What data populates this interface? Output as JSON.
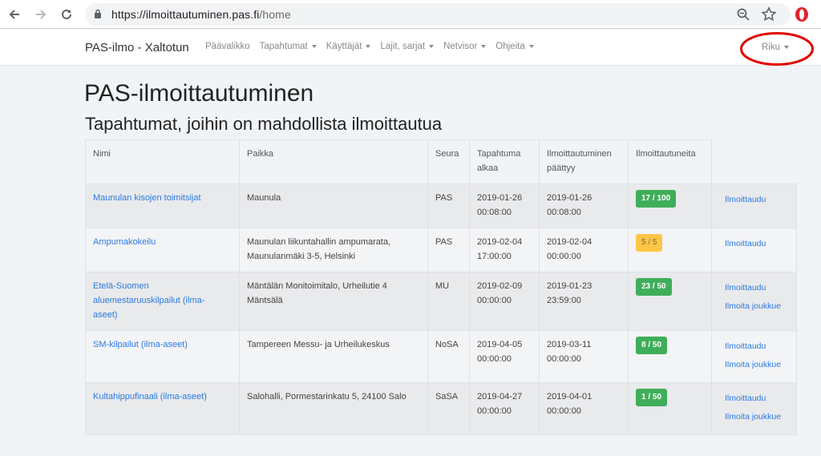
{
  "browser": {
    "url_host": "https://ilmoittautuminen.pas.fi",
    "url_path": "/home"
  },
  "navbar": {
    "brand": "PAS-ilmo - Xaltotun",
    "items": [
      {
        "label": "Päävalikko",
        "dropdown": false
      },
      {
        "label": "Tapahtumat",
        "dropdown": true
      },
      {
        "label": "Käyttäjät",
        "dropdown": true
      },
      {
        "label": "Lajit, sarjat",
        "dropdown": true
      },
      {
        "label": "Netvisor",
        "dropdown": true
      },
      {
        "label": "Ohjeita",
        "dropdown": true
      }
    ],
    "user": "Riku"
  },
  "page": {
    "title": "PAS-ilmoittautuminen",
    "subtitle": "Tapahtumat, joihin on mahdollista ilmoittautua"
  },
  "table": {
    "headers": {
      "name": "Nimi",
      "place": "Paikka",
      "club": "Seura",
      "event_start_1": "Tapahtuma",
      "event_start_2": "alkaa",
      "reg_end_1": "Ilmoittautuminen",
      "reg_end_2": "päättyy",
      "registered": "Ilmoittautuneita"
    },
    "rows": [
      {
        "name_lines": [
          "Maunulan kisojen toimitsijat"
        ],
        "place_lines": [
          "Maunula"
        ],
        "club": "PAS",
        "start_date": "2019-01-26",
        "start_time": "00:08:00",
        "end_date": "2019-01-26",
        "end_time": "00:08:00",
        "badge": "17 / 100",
        "badge_color": "#3fae5a",
        "actions": [
          "Ilmoittaudu"
        ]
      },
      {
        "name_lines": [
          "Ampumakokeilu"
        ],
        "place_lines": [
          "Maunulan liikuntahallin ampumarata,",
          "Maunulanmäki 3-5, Helsinki"
        ],
        "club": "PAS",
        "start_date": "2019-02-04",
        "start_time": "17:00:00",
        "end_date": "2019-02-04",
        "end_time": "00:00:00",
        "badge": "5 / 5",
        "badge_color": "#ffc646",
        "actions": [
          "Ilmoittaudu"
        ]
      },
      {
        "name_lines": [
          "Etelä-Suomen",
          "aluemestaruuskilpailut (ilma-",
          "aseet)"
        ],
        "place_lines": [
          "Mäntälän Monitoimitalo, Urheilutie 4",
          "Mäntsälä"
        ],
        "club": "MU",
        "start_date": "2019-02-09",
        "start_time": "00:00:00",
        "end_date": "2019-01-23",
        "end_time": "23:59:00",
        "badge": "23 / 50",
        "badge_color": "#3fae5a",
        "actions": [
          "Ilmoittaudu",
          "Ilmoita joukkue"
        ]
      },
      {
        "name_lines": [
          "SM-kilpailut (ilma-aseet)"
        ],
        "place_lines": [
          "Tampereen Messu- ja Urheilukeskus"
        ],
        "club": "NoSA",
        "start_date": "2019-04-05",
        "start_time": "00:00:00",
        "end_date": "2019-03-11",
        "end_time": "00:00:00",
        "badge": "8 / 50",
        "badge_color": "#3fae5a",
        "actions": [
          "Ilmoittaudu",
          "Ilmoita joukkue"
        ]
      },
      {
        "name_lines": [
          "Kultahippufinaali (ilma-aseet)"
        ],
        "place_lines": [
          "Salohalli, Pormestarinkatu 5, 24100 Salo"
        ],
        "club": "SaSA",
        "start_date": "2019-04-27",
        "start_time": "00:00:00",
        "end_date": "2019-04-01",
        "end_time": "00:00:00",
        "badge": "1 / 50",
        "badge_color": "#3fae5a",
        "actions": [
          "Ilmoittaudu",
          "Ilmoita joukkue"
        ]
      }
    ]
  }
}
